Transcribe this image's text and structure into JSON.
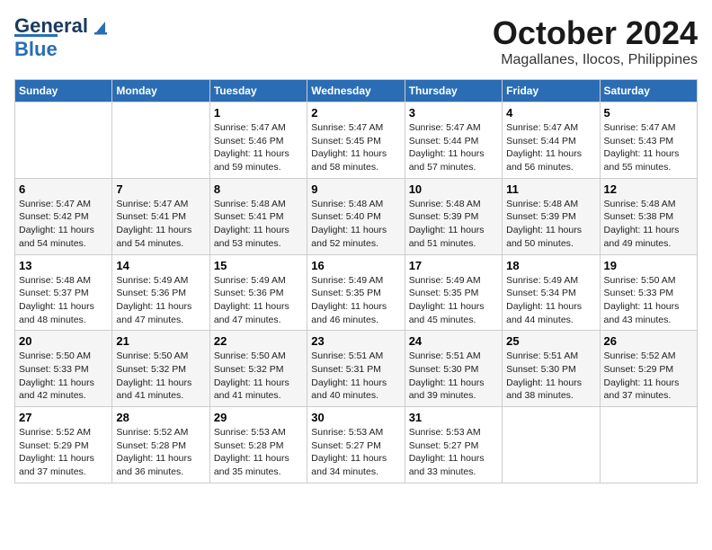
{
  "header": {
    "logo": {
      "line1": "General",
      "line2": "Blue"
    },
    "title": "October 2024",
    "subtitle": "Magallanes, Ilocos, Philippines"
  },
  "weekdays": [
    "Sunday",
    "Monday",
    "Tuesday",
    "Wednesday",
    "Thursday",
    "Friday",
    "Saturday"
  ],
  "weeks": [
    [
      {
        "day": "",
        "sunrise": "",
        "sunset": "",
        "daylight": ""
      },
      {
        "day": "",
        "sunrise": "",
        "sunset": "",
        "daylight": ""
      },
      {
        "day": "1",
        "sunrise": "Sunrise: 5:47 AM",
        "sunset": "Sunset: 5:46 PM",
        "daylight": "Daylight: 11 hours and 59 minutes."
      },
      {
        "day": "2",
        "sunrise": "Sunrise: 5:47 AM",
        "sunset": "Sunset: 5:45 PM",
        "daylight": "Daylight: 11 hours and 58 minutes."
      },
      {
        "day": "3",
        "sunrise": "Sunrise: 5:47 AM",
        "sunset": "Sunset: 5:44 PM",
        "daylight": "Daylight: 11 hours and 57 minutes."
      },
      {
        "day": "4",
        "sunrise": "Sunrise: 5:47 AM",
        "sunset": "Sunset: 5:44 PM",
        "daylight": "Daylight: 11 hours and 56 minutes."
      },
      {
        "day": "5",
        "sunrise": "Sunrise: 5:47 AM",
        "sunset": "Sunset: 5:43 PM",
        "daylight": "Daylight: 11 hours and 55 minutes."
      }
    ],
    [
      {
        "day": "6",
        "sunrise": "Sunrise: 5:47 AM",
        "sunset": "Sunset: 5:42 PM",
        "daylight": "Daylight: 11 hours and 54 minutes."
      },
      {
        "day": "7",
        "sunrise": "Sunrise: 5:47 AM",
        "sunset": "Sunset: 5:41 PM",
        "daylight": "Daylight: 11 hours and 54 minutes."
      },
      {
        "day": "8",
        "sunrise": "Sunrise: 5:48 AM",
        "sunset": "Sunset: 5:41 PM",
        "daylight": "Daylight: 11 hours and 53 minutes."
      },
      {
        "day": "9",
        "sunrise": "Sunrise: 5:48 AM",
        "sunset": "Sunset: 5:40 PM",
        "daylight": "Daylight: 11 hours and 52 minutes."
      },
      {
        "day": "10",
        "sunrise": "Sunrise: 5:48 AM",
        "sunset": "Sunset: 5:39 PM",
        "daylight": "Daylight: 11 hours and 51 minutes."
      },
      {
        "day": "11",
        "sunrise": "Sunrise: 5:48 AM",
        "sunset": "Sunset: 5:39 PM",
        "daylight": "Daylight: 11 hours and 50 minutes."
      },
      {
        "day": "12",
        "sunrise": "Sunrise: 5:48 AM",
        "sunset": "Sunset: 5:38 PM",
        "daylight": "Daylight: 11 hours and 49 minutes."
      }
    ],
    [
      {
        "day": "13",
        "sunrise": "Sunrise: 5:48 AM",
        "sunset": "Sunset: 5:37 PM",
        "daylight": "Daylight: 11 hours and 48 minutes."
      },
      {
        "day": "14",
        "sunrise": "Sunrise: 5:49 AM",
        "sunset": "Sunset: 5:36 PM",
        "daylight": "Daylight: 11 hours and 47 minutes."
      },
      {
        "day": "15",
        "sunrise": "Sunrise: 5:49 AM",
        "sunset": "Sunset: 5:36 PM",
        "daylight": "Daylight: 11 hours and 47 minutes."
      },
      {
        "day": "16",
        "sunrise": "Sunrise: 5:49 AM",
        "sunset": "Sunset: 5:35 PM",
        "daylight": "Daylight: 11 hours and 46 minutes."
      },
      {
        "day": "17",
        "sunrise": "Sunrise: 5:49 AM",
        "sunset": "Sunset: 5:35 PM",
        "daylight": "Daylight: 11 hours and 45 minutes."
      },
      {
        "day": "18",
        "sunrise": "Sunrise: 5:49 AM",
        "sunset": "Sunset: 5:34 PM",
        "daylight": "Daylight: 11 hours and 44 minutes."
      },
      {
        "day": "19",
        "sunrise": "Sunrise: 5:50 AM",
        "sunset": "Sunset: 5:33 PM",
        "daylight": "Daylight: 11 hours and 43 minutes."
      }
    ],
    [
      {
        "day": "20",
        "sunrise": "Sunrise: 5:50 AM",
        "sunset": "Sunset: 5:33 PM",
        "daylight": "Daylight: 11 hours and 42 minutes."
      },
      {
        "day": "21",
        "sunrise": "Sunrise: 5:50 AM",
        "sunset": "Sunset: 5:32 PM",
        "daylight": "Daylight: 11 hours and 41 minutes."
      },
      {
        "day": "22",
        "sunrise": "Sunrise: 5:50 AM",
        "sunset": "Sunset: 5:32 PM",
        "daylight": "Daylight: 11 hours and 41 minutes."
      },
      {
        "day": "23",
        "sunrise": "Sunrise: 5:51 AM",
        "sunset": "Sunset: 5:31 PM",
        "daylight": "Daylight: 11 hours and 40 minutes."
      },
      {
        "day": "24",
        "sunrise": "Sunrise: 5:51 AM",
        "sunset": "Sunset: 5:30 PM",
        "daylight": "Daylight: 11 hours and 39 minutes."
      },
      {
        "day": "25",
        "sunrise": "Sunrise: 5:51 AM",
        "sunset": "Sunset: 5:30 PM",
        "daylight": "Daylight: 11 hours and 38 minutes."
      },
      {
        "day": "26",
        "sunrise": "Sunrise: 5:52 AM",
        "sunset": "Sunset: 5:29 PM",
        "daylight": "Daylight: 11 hours and 37 minutes."
      }
    ],
    [
      {
        "day": "27",
        "sunrise": "Sunrise: 5:52 AM",
        "sunset": "Sunset: 5:29 PM",
        "daylight": "Daylight: 11 hours and 37 minutes."
      },
      {
        "day": "28",
        "sunrise": "Sunrise: 5:52 AM",
        "sunset": "Sunset: 5:28 PM",
        "daylight": "Daylight: 11 hours and 36 minutes."
      },
      {
        "day": "29",
        "sunrise": "Sunrise: 5:53 AM",
        "sunset": "Sunset: 5:28 PM",
        "daylight": "Daylight: 11 hours and 35 minutes."
      },
      {
        "day": "30",
        "sunrise": "Sunrise: 5:53 AM",
        "sunset": "Sunset: 5:27 PM",
        "daylight": "Daylight: 11 hours and 34 minutes."
      },
      {
        "day": "31",
        "sunrise": "Sunrise: 5:53 AM",
        "sunset": "Sunset: 5:27 PM",
        "daylight": "Daylight: 11 hours and 33 minutes."
      },
      {
        "day": "",
        "sunrise": "",
        "sunset": "",
        "daylight": ""
      },
      {
        "day": "",
        "sunrise": "",
        "sunset": "",
        "daylight": ""
      }
    ]
  ]
}
